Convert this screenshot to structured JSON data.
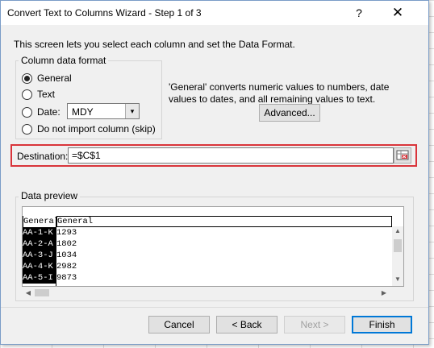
{
  "window": {
    "title": "Convert Text to Columns Wizard - Step 1 of 3",
    "help_glyph": "?",
    "close_glyph": "✕"
  },
  "intro": "This screen lets you select each column and set the Data Format.",
  "column_format": {
    "legend": "Column data format",
    "options": [
      {
        "label": "General",
        "selected": true
      },
      {
        "label": "Text",
        "selected": false
      },
      {
        "label": "Date:",
        "selected": false
      },
      {
        "label": "Do not import column (skip)",
        "selected": false
      }
    ],
    "date_value": "MDY",
    "date_arrow": "▾"
  },
  "description": "'General' converts numeric values to numbers, date values to dates, and all remaining values to text.",
  "advanced_label": "Advanced...",
  "destination": {
    "label": "Destination:",
    "value": "=$C$1"
  },
  "preview": {
    "legend": "Data preview",
    "headers": [
      "General",
      "General"
    ],
    "rows": [
      [
        "AA-1-K",
        "1293"
      ],
      [
        "AA-2-A",
        "1802"
      ],
      [
        "AA-3-J",
        "1034"
      ],
      [
        "AA-4-K",
        "2982"
      ],
      [
        "AA-5-I",
        "9873"
      ]
    ]
  },
  "scroll_glyphs": {
    "up": "▲",
    "down": "▼",
    "left": "◀",
    "right": "▶"
  },
  "buttons": {
    "cancel": "Cancel",
    "back": "< Back",
    "next": "Next >",
    "finish": "Finish"
  },
  "colors": {
    "highlight_outline": "#d9343a",
    "default_button_border": "#0078d7"
  }
}
